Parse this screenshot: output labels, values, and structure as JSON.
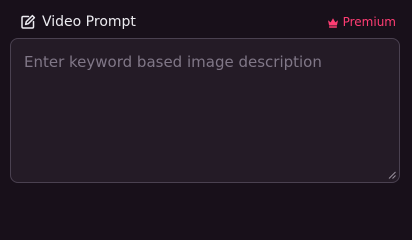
{
  "header": {
    "title": "Video Prompt",
    "title_icon": "edit-icon",
    "premium_label": "Premium",
    "premium_icon": "crown-icon"
  },
  "prompt": {
    "value": "",
    "placeholder": "Enter keyword based image description"
  },
  "colors": {
    "background": "#18101a",
    "field_background": "#241b26",
    "field_border": "#4a4150",
    "accent": "#ff3d73",
    "title_text": "#ecebf0",
    "placeholder_text": "#807787"
  }
}
